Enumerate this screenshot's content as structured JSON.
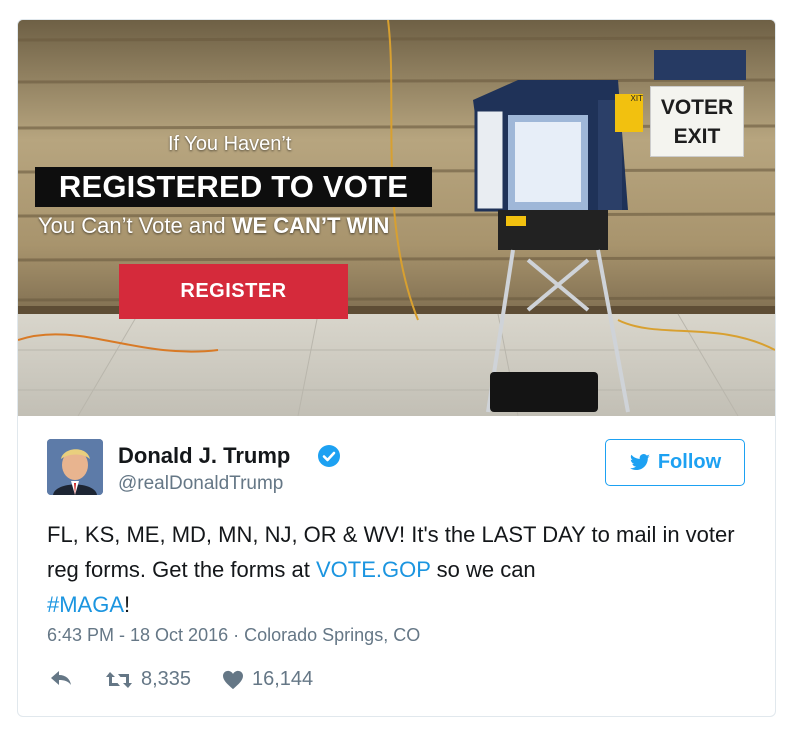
{
  "media": {
    "line1": "If You Haven’t",
    "line2": "REGISTERED TO VOTE",
    "line3_a": "You Can’t Vote and ",
    "line3_b": "WE CAN’T WIN",
    "register_label": "REGISTER",
    "sign_line1": "VOTER",
    "sign_line2": "EXIT",
    "small_exit": "XIT"
  },
  "user": {
    "display_name": "Donald J. Trump",
    "handle": "@realDonaldTrump"
  },
  "follow_label": "Follow",
  "tweet": {
    "text_before": "FL, KS, ME, MD, MN, NJ, OR & WV! It's the LAST DAY to mail in voter reg forms. Get the forms at ",
    "link": "VOTE.GOP",
    "text_middle": " so we can ",
    "hashtag": "#MAGA",
    "text_after": "!"
  },
  "meta": {
    "time": "6:43 PM - 18 Oct 2016",
    "separator": " · ",
    "location": "Colorado Springs, CO"
  },
  "actions": {
    "retweets": "8,335",
    "likes": "16,144"
  },
  "colors": {
    "brand_blue": "#1da1f2",
    "link_blue": "#1b95e0",
    "register_red": "#d52a3b",
    "meta_gray": "#657786"
  }
}
